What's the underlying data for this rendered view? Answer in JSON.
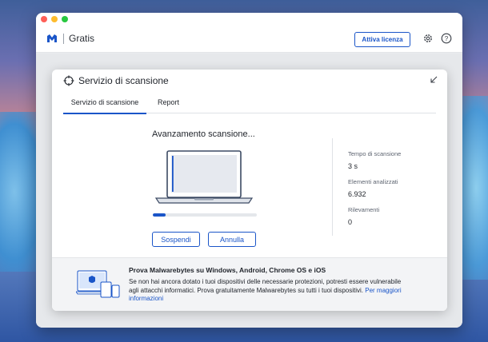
{
  "app": {
    "brand_name": "Gratis",
    "activate_label": "Attiva licenza",
    "accent_color": "#1a55c8"
  },
  "icons": {
    "logo": "malwarebytes-logo-icon",
    "settings": "gear-icon",
    "help": "help-icon",
    "scan": "crosshair-icon",
    "collapse": "collapse-arrow-icon"
  },
  "modal": {
    "title": "Servizio di scansione",
    "tabs": [
      {
        "label": "Servizio di scansione",
        "active": true
      },
      {
        "label": "Report",
        "active": false
      }
    ]
  },
  "scan": {
    "heading": "Avanzamento scansione...",
    "progress": 0.12,
    "suspend_label": "Sospendi",
    "cancel_label": "Annulla",
    "stats": [
      {
        "label": "Tempo di scansione",
        "value": "3 s"
      },
      {
        "label": "Elementi analizzati",
        "value": "6.932"
      },
      {
        "label": "Rilevamenti",
        "value": "0"
      }
    ]
  },
  "promo": {
    "title": "Prova Malwarebytes su Windows, Android, Chrome OS e iOS",
    "body": "Se non hai ancora dotato i tuoi dispositivi delle necessarie protezioni, potresti essere vulnerabile agli attacchi informatici. Prova gratuitamente Malwarebytes su tutti i tuoi dispositivi.",
    "link": "Per maggiori informazioni"
  }
}
